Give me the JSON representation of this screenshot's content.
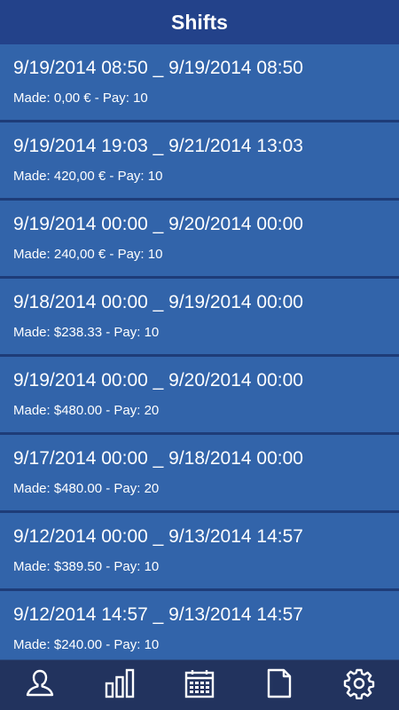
{
  "header": {
    "title": "Shifts"
  },
  "shifts": [
    {
      "range": "9/19/2014 08:50 _ 9/19/2014 08:50",
      "meta": "Made: 0,00 € - Pay: 10"
    },
    {
      "range": "9/19/2014 19:03 _ 9/21/2014 13:03",
      "meta": "Made: 420,00 € - Pay: 10"
    },
    {
      "range": "9/19/2014 00:00 _ 9/20/2014 00:00",
      "meta": "Made: 240,00 € - Pay: 10"
    },
    {
      "range": "9/18/2014 00:00 _ 9/19/2014 00:00",
      "meta": "Made: $238.33 - Pay: 10"
    },
    {
      "range": "9/19/2014 00:00 _ 9/20/2014 00:00",
      "meta": "Made: $480.00 - Pay: 20"
    },
    {
      "range": "9/17/2014 00:00 _ 9/18/2014 00:00",
      "meta": "Made: $480.00 - Pay: 20"
    },
    {
      "range": "9/12/2014 00:00 _ 9/13/2014 14:57",
      "meta": "Made: $389.50 - Pay: 10"
    },
    {
      "range": "9/12/2014 14:57 _ 9/13/2014 14:57",
      "meta": "Made: $240.00 - Pay: 10"
    }
  ],
  "tabbar": {
    "items": [
      {
        "icon": "profile-icon"
      },
      {
        "icon": "bar-chart-icon"
      },
      {
        "icon": "calendar-icon"
      },
      {
        "icon": "document-icon"
      },
      {
        "icon": "gear-icon"
      }
    ]
  },
  "colors": {
    "header_bg": "#23428a",
    "item_bg": "#3264aa",
    "divider": "#1e3c78",
    "tabbar_bg": "#22335e"
  }
}
